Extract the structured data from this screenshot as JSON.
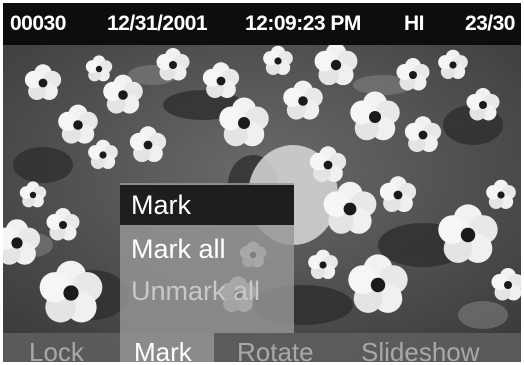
{
  "status_bar": {
    "file_number": "00030",
    "date": "12/31/2001",
    "time": "12:09:23 PM",
    "quality": "HI",
    "image_index": "23/30"
  },
  "menu": {
    "items": [
      {
        "label": "Mark",
        "state": "selected"
      },
      {
        "label": "Mark all",
        "state": "enabled"
      },
      {
        "label": "Unmark all",
        "state": "disabled"
      }
    ]
  },
  "softkeys": {
    "lock": "Lock",
    "mark": "Mark",
    "rotate": "Rotate",
    "slideshow": "Slideshow",
    "active": "Mark"
  },
  "colors": {
    "status_bar_bg": "#0d0d0d",
    "menu_selected_bg": "#1e1e1e",
    "menu_bg": "#969696",
    "text": "#ffffff",
    "inactive_text": "#a8a8a8"
  }
}
